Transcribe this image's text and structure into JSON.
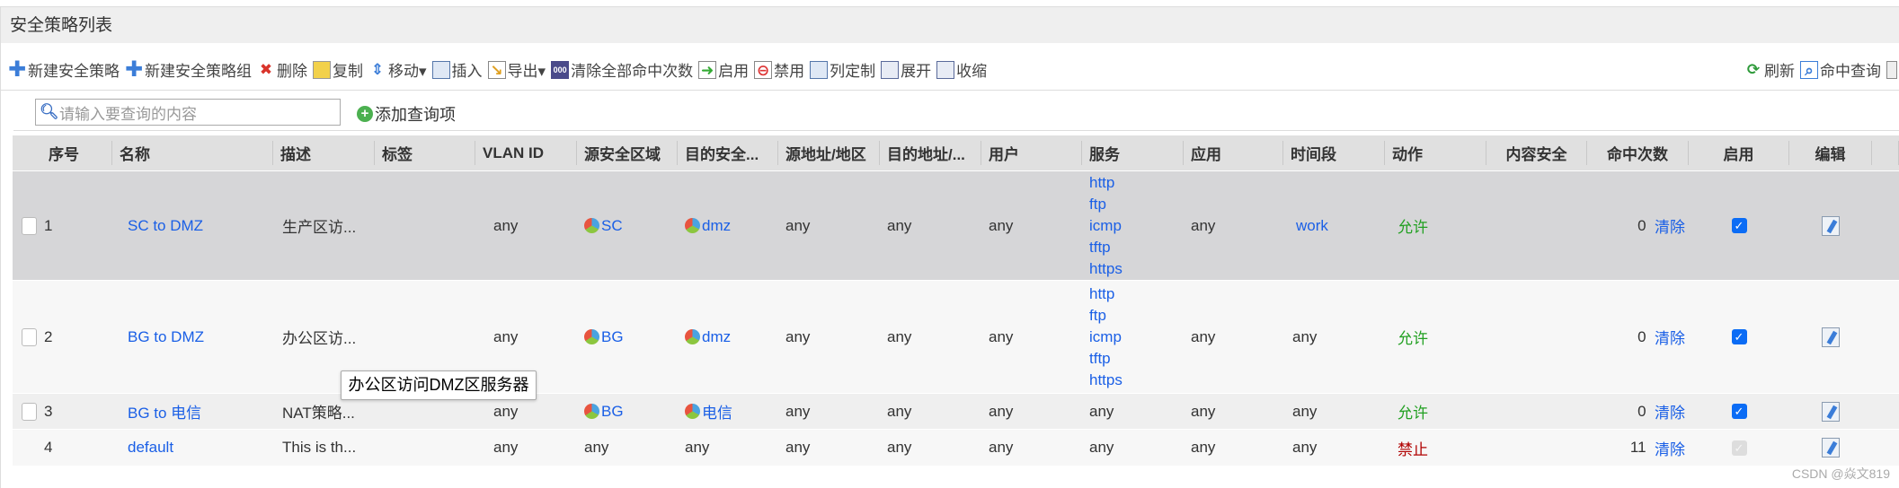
{
  "title": "安全策略列表",
  "toolbar": {
    "left": [
      {
        "label": "新建安全策略",
        "icon": "plus-icon"
      },
      {
        "label": "新建安全策略组",
        "icon": "plus-icon"
      },
      {
        "label": "删除",
        "icon": "delete-icon"
      },
      {
        "label": "复制",
        "icon": "copy-icon"
      },
      {
        "label": "移动▾",
        "icon": "move-icon"
      },
      {
        "label": "插入",
        "icon": "insert-icon"
      },
      {
        "label": "导出▾",
        "icon": "export-icon"
      },
      {
        "label": "清除全部命中次数",
        "icon": "clear-count-icon"
      },
      {
        "label": "启用",
        "icon": "enable-icon"
      },
      {
        "label": "禁用",
        "icon": "disable-icon"
      },
      {
        "label": "列定制",
        "icon": "columns-icon"
      },
      {
        "label": "展开",
        "icon": "expand-icon"
      },
      {
        "label": "收缩",
        "icon": "collapse-icon"
      }
    ],
    "right": [
      {
        "label": "刷新",
        "icon": "refresh-icon"
      },
      {
        "label": "命中查询",
        "icon": "hit-query-icon"
      }
    ]
  },
  "search": {
    "placeholder": "请输入要查询的内容",
    "add_label": "添加查询项"
  },
  "columns": [
    "序号",
    "名称",
    "描述",
    "标签",
    "VLAN ID",
    "源安全区域",
    "目的安全...",
    "源地址/地区",
    "目的地址/...",
    "用户",
    "服务",
    "应用",
    "时间段",
    "动作",
    "内容安全",
    "命中次数",
    "启用",
    "编辑",
    ""
  ],
  "rows": [
    {
      "no": "1",
      "name": "SC to DMZ",
      "desc": "生产区访...",
      "tag": "",
      "vlan": "any",
      "src_zone": "SC",
      "dst_zone": "dmz",
      "src_addr": "any",
      "dst_addr": "any",
      "user": "any",
      "services": [
        "http",
        "ftp",
        "icmp",
        "tftp",
        "https"
      ],
      "app": "any",
      "time": "work",
      "action": "允许",
      "content": "",
      "hits": "0",
      "clear": "清除",
      "enabled": true,
      "checkbox": true
    },
    {
      "no": "2",
      "name": "BG to DMZ",
      "desc": "办公区访...",
      "tag": "",
      "vlan": "any",
      "src_zone": "BG",
      "dst_zone": "dmz",
      "src_addr": "any",
      "dst_addr": "any",
      "user": "any",
      "services": [
        "http",
        "ftp",
        "icmp",
        "tftp",
        "https"
      ],
      "app": "any",
      "time": "any",
      "action": "允许",
      "content": "",
      "hits": "0",
      "clear": "清除",
      "enabled": true,
      "checkbox": true
    },
    {
      "no": "3",
      "name": "BG to 电信",
      "desc": "NAT策略...",
      "tag": "",
      "vlan": "any",
      "src_zone": "BG",
      "dst_zone": "电信",
      "src_addr": "any",
      "dst_addr": "any",
      "user": "any",
      "services": [
        "any"
      ],
      "app": "any",
      "time": "any",
      "action": "允许",
      "content": "",
      "hits": "0",
      "clear": "清除",
      "enabled": true,
      "checkbox": true
    },
    {
      "no": "4",
      "name": "default",
      "desc": "This is th...",
      "tag": "",
      "vlan": "any",
      "src_zone": "any",
      "dst_zone": "any",
      "src_addr": "any",
      "dst_addr": "any",
      "user": "any",
      "services": [
        "any"
      ],
      "app": "any",
      "time": "any",
      "action": "禁止",
      "content": "",
      "hits": "11",
      "clear": "清除",
      "enabled": true,
      "checkbox": false,
      "enabled_disabled": true
    }
  ],
  "tooltip": "办公区访问DMZ区服务器",
  "watermark": "CSDN @焱文819",
  "colors": {
    "link": "#1a5fe6",
    "allow": "#22a022",
    "deny": "#b00000",
    "selected_row": "#d6d6d8",
    "header": "#e0e0e0"
  }
}
